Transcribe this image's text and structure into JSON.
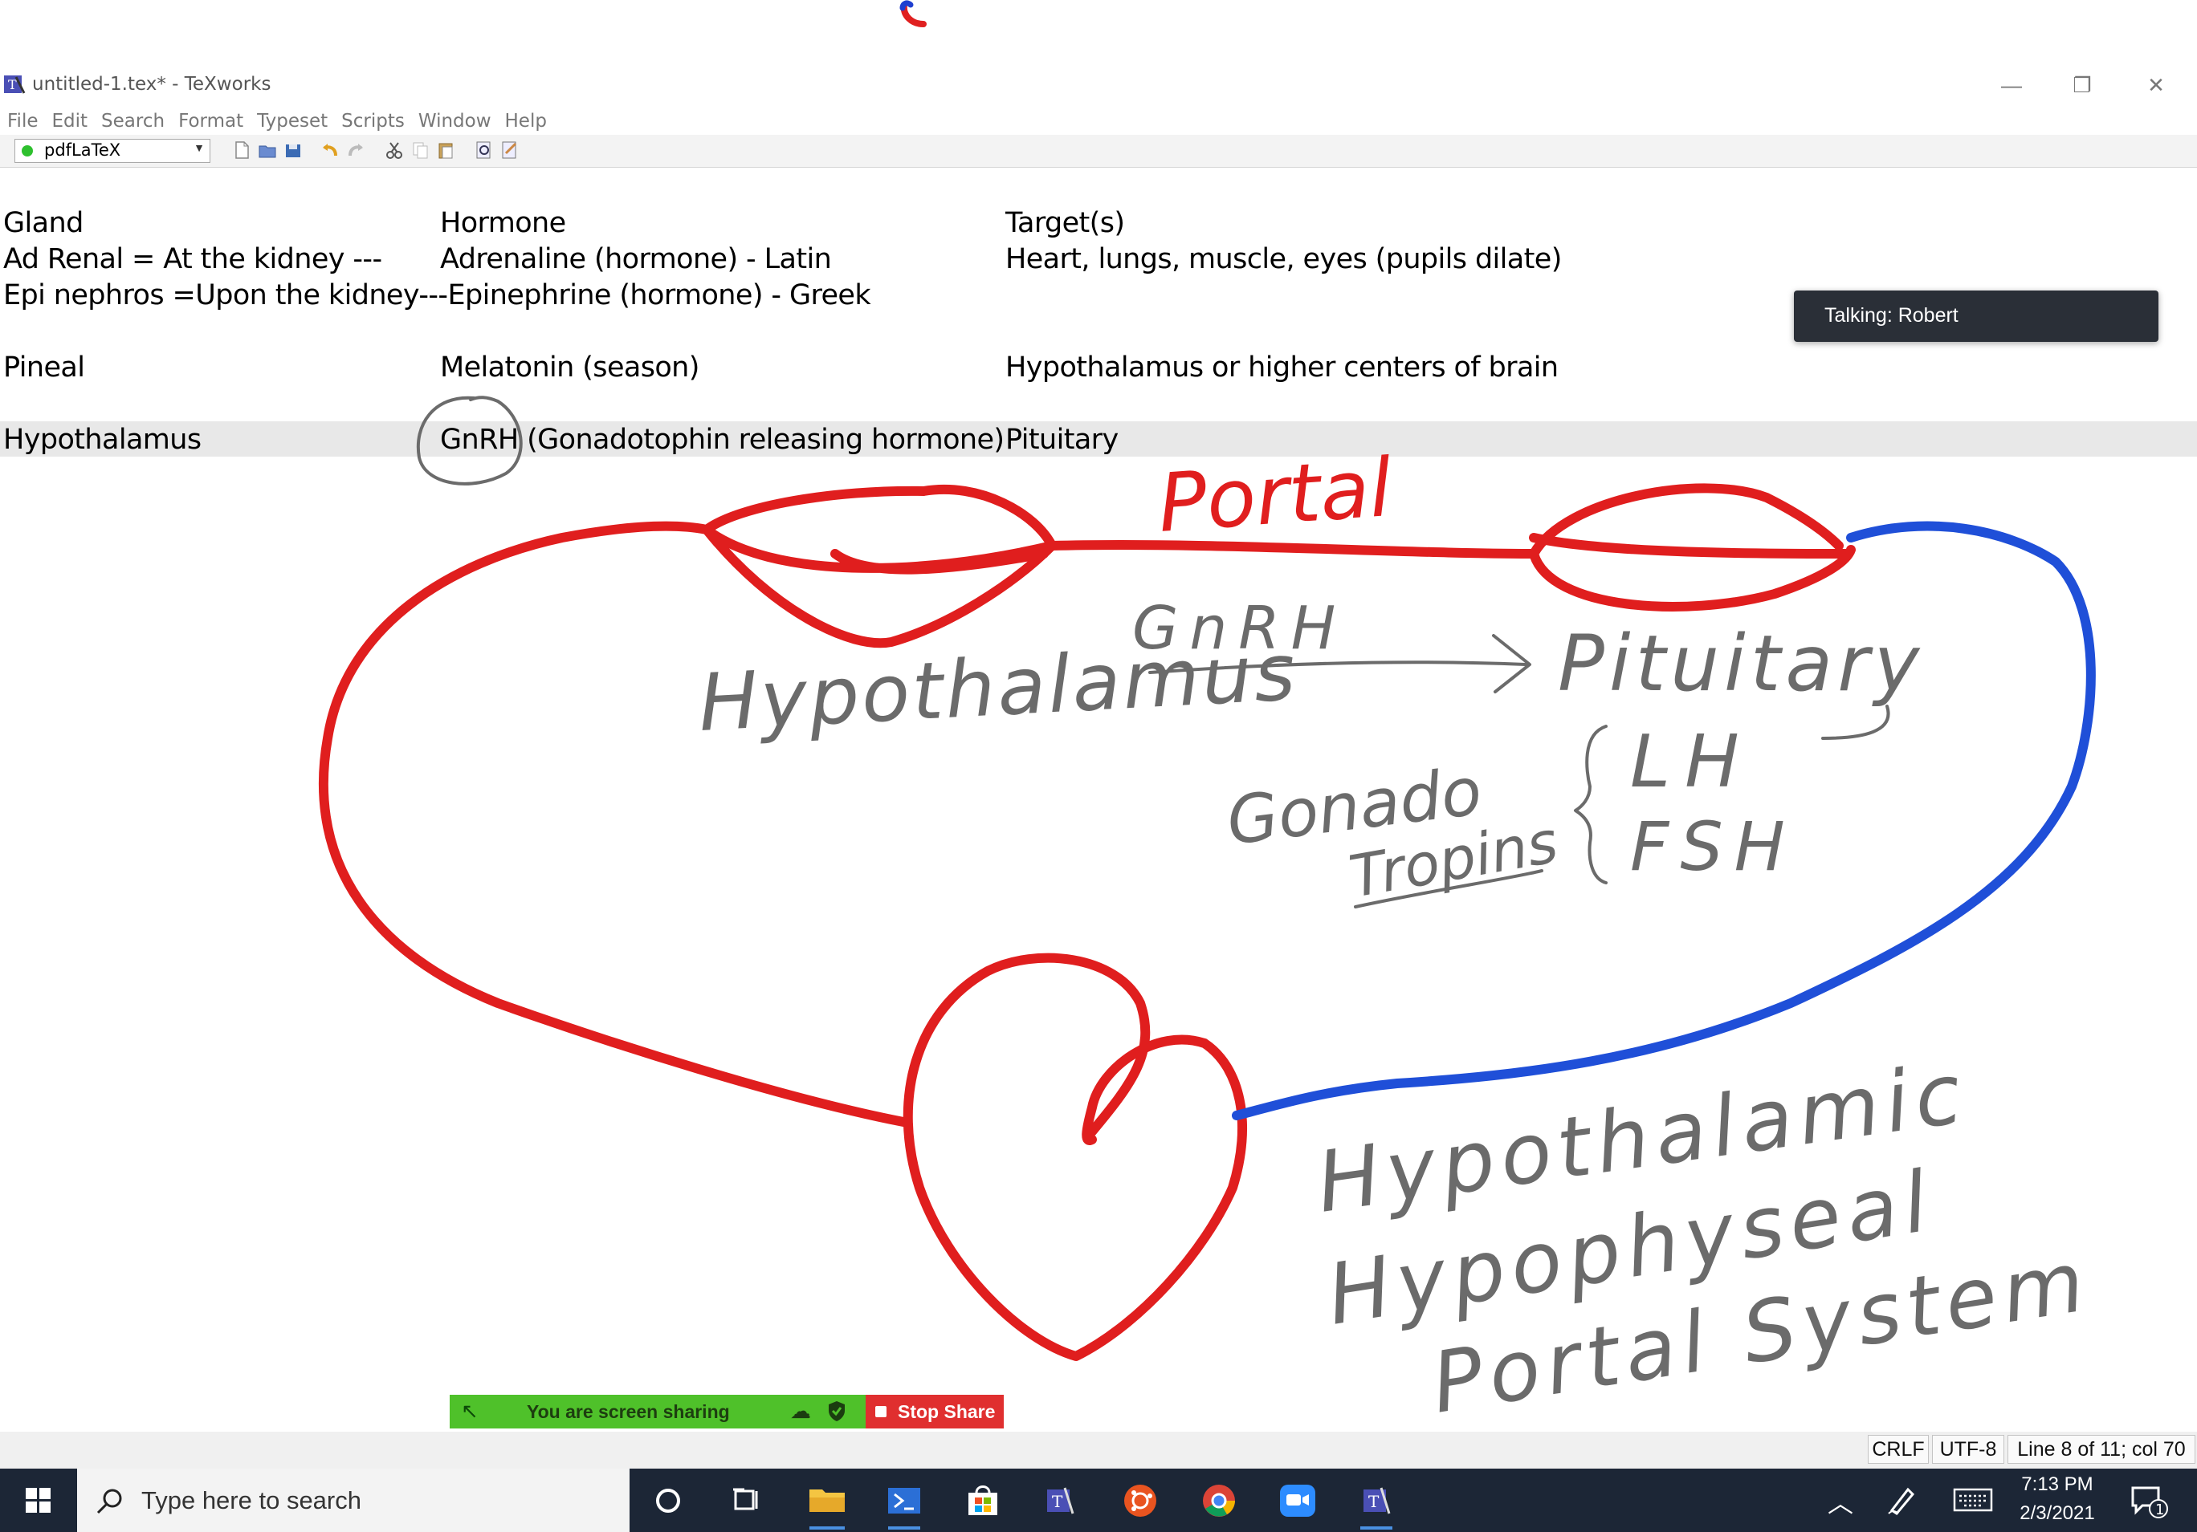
{
  "window": {
    "title": "untitled-1.tex* - TeXworks",
    "minimize_glyph": "—",
    "maximize_glyph": "❐",
    "close_glyph": "✕"
  },
  "menu": [
    "File",
    "Edit",
    "Search",
    "Format",
    "Typeset",
    "Scripts",
    "Window",
    "Help"
  ],
  "toolbar": {
    "engine": "pdfLaTeX",
    "icons": [
      "typeset-dot-icon",
      "new-file-icon",
      "open-file-icon",
      "save-icon",
      "undo-icon",
      "redo-icon",
      "cut-icon",
      "copy-icon",
      "paste-icon",
      "find-icon",
      "replace-icon"
    ]
  },
  "editor": {
    "lines": [
      {
        "c1": "Gland",
        "c2": "Hormone",
        "c3": "Target(s)"
      },
      {
        "c1": "Ad Renal = At the kidney ---",
        "c2": "Adrenaline (hormone) - Latin",
        "c3": "Heart, lungs, muscle, eyes (pupils dilate)"
      },
      {
        "c1": "Epi nephros =Upon the kidney---Epinephrine (hormone) - Greek",
        "c2": "",
        "c3": ""
      },
      {
        "c1": "",
        "c2": "",
        "c3": ""
      },
      {
        "c1": "Pineal",
        "c2": "Melatonin (season)",
        "c3": "Hypothalamus or higher centers of brain"
      },
      {
        "c1": "",
        "c2": "",
        "c3": ""
      },
      {
        "c1": "Hypothalamus",
        "c2": "GnRH (Gonadotophin releasing hormone)",
        "c3": "Pituitary"
      }
    ],
    "highlighted_line": 7
  },
  "annotations": {
    "portal": "Portal",
    "gnrh": "GnRH",
    "hypothalamus": "Hypothalamus",
    "pituitary": "Pituitary",
    "gonado": "Gonado",
    "tropins": "Tropins",
    "lh": "LH",
    "fsh": "FSH",
    "system_line1": "Hypothalamic",
    "system_line2": "Hypophyseal",
    "system_line3": "Portal System",
    "colors": {
      "artery": "#e01e1e",
      "vein": "#1f4fd8",
      "pencil": "#6b6b6b"
    }
  },
  "talking": "Talking: Robert",
  "share": {
    "message": "You are screen sharing",
    "stop": "Stop Share"
  },
  "status": {
    "eol": "CRLF",
    "encoding": "UTF-8",
    "position": "Line 8 of 11; col 70"
  },
  "taskbar": {
    "search_placeholder": "Type here to search",
    "apps": [
      "cortana-icon",
      "task-view-icon",
      "file-explorer-icon",
      "powershell-icon",
      "store-icon",
      "texworks-icon",
      "ubuntu-icon",
      "chrome-icon",
      "zoom-icon",
      "texworks-icon"
    ],
    "time": "7:13 PM",
    "date": "2/3/2021",
    "notifications": "1"
  }
}
